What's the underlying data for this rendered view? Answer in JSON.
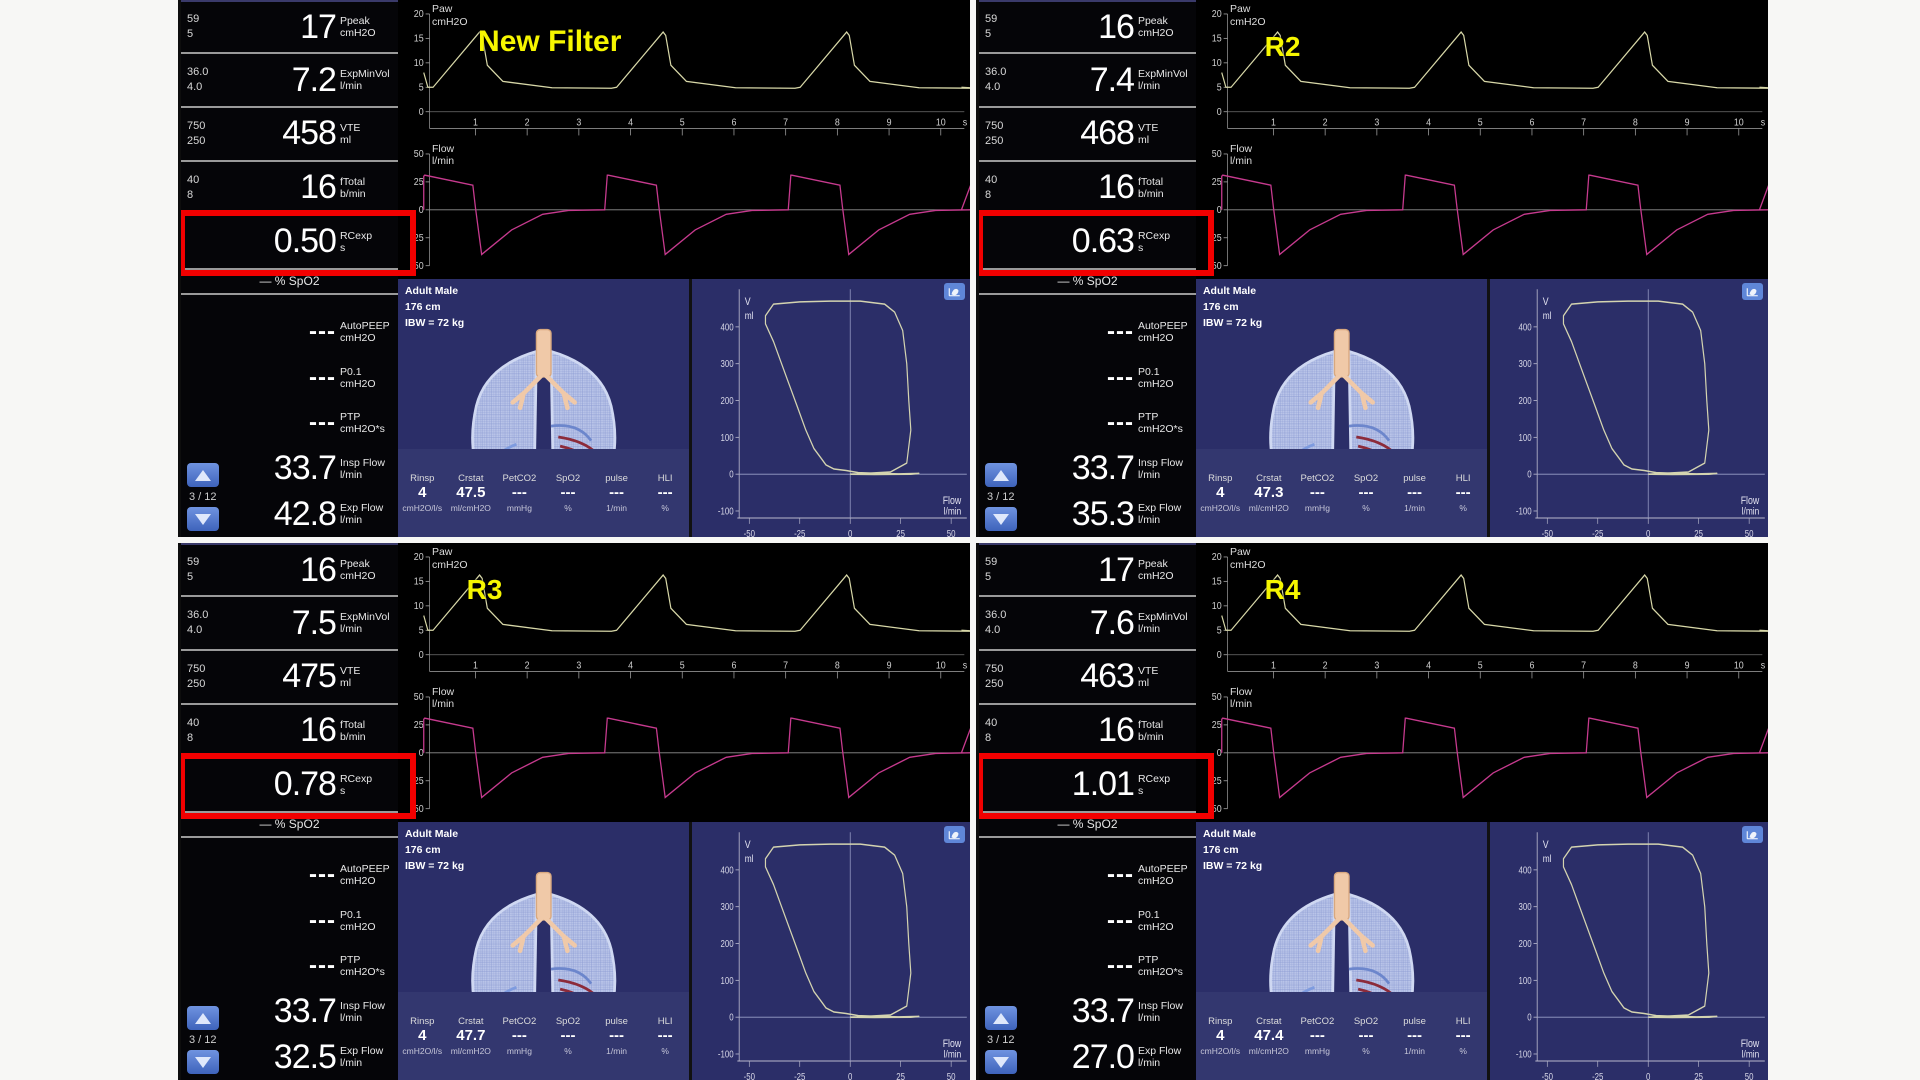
{
  "panels": [
    {
      "id": "p1",
      "annotation": "New Filter",
      "numeric": [
        {
          "hi": "59",
          "lo": "5",
          "value": "17",
          "label": "Ppeak",
          "unit": "cmH2O"
        },
        {
          "hi": "36.0",
          "lo": "4.0",
          "value": "7.2",
          "label": "ExpMinVol",
          "unit": "l/min"
        },
        {
          "hi": "750",
          "lo": "250",
          "value": "458",
          "label": "VTE",
          "unit": "ml"
        },
        {
          "hi": "40",
          "lo": "8",
          "value": "16",
          "label": "fTotal",
          "unit": "b/min"
        }
      ],
      "rcexp": {
        "value": "0.50",
        "label": "RCexp",
        "unit": "s"
      },
      "spo2_label": "— % SpO2",
      "dashed": [
        {
          "value": "---",
          "label": "AutoPEEP",
          "unit": "cmH2O"
        },
        {
          "value": "---",
          "label": "P0.1",
          "unit": "cmH2O"
        },
        {
          "value": "---",
          "label": "PTP",
          "unit": "cmH2O*s"
        }
      ],
      "flows": [
        {
          "value": "33.7",
          "label": "Insp Flow",
          "unit": "l/min"
        },
        {
          "value": "42.8",
          "label": "Exp Flow",
          "unit": "l/min"
        }
      ],
      "page": "3 / 12",
      "paw": {
        "title": "Paw",
        "unit": "cmH2O",
        "yticks": [
          "20",
          "15",
          "10",
          "5",
          "0"
        ],
        "xticks": [
          "1",
          "2",
          "3",
          "4",
          "5",
          "6",
          "7",
          "8",
          "9",
          "10"
        ],
        "xend": "s"
      },
      "flow": {
        "title": "Flow",
        "unit": "l/min",
        "yticks": [
          "50",
          "25",
          "0",
          "-25",
          "-50"
        ]
      },
      "patient": {
        "type": "Adult Male",
        "height": "176 cm",
        "ibw": "IBW = 72 kg"
      },
      "status": [
        {
          "label": "Rinsp",
          "value": "4",
          "unit": "cmH2O/l/s"
        },
        {
          "label": "Crstat",
          "value": "47.5",
          "unit": "ml/cmH2O"
        },
        {
          "label": "PetCO2",
          "value": "---",
          "unit": "mmHg"
        },
        {
          "label": "SpO2",
          "value": "---",
          "unit": "%"
        },
        {
          "label": "pulse",
          "value": "---",
          "unit": "1/min"
        },
        {
          "label": "HLI",
          "value": "---",
          "unit": "%"
        }
      ],
      "loop": {
        "ylabel": "V",
        "yunit": "ml",
        "xlabel": "Flow",
        "xunit": "l/min",
        "yticks": [
          "400",
          "300",
          "200",
          "100",
          "0",
          "-100"
        ],
        "xticks": [
          "-50",
          "-25",
          "0",
          "25",
          "50"
        ]
      }
    },
    {
      "id": "p2",
      "annotation": "R2",
      "numeric": [
        {
          "hi": "59",
          "lo": "5",
          "value": "16",
          "label": "Ppeak",
          "unit": "cmH2O"
        },
        {
          "hi": "36.0",
          "lo": "4.0",
          "value": "7.4",
          "label": "ExpMinVol",
          "unit": "l/min"
        },
        {
          "hi": "750",
          "lo": "250",
          "value": "468",
          "label": "VTE",
          "unit": "ml"
        },
        {
          "hi": "40",
          "lo": "8",
          "value": "16",
          "label": "fTotal",
          "unit": "b/min"
        }
      ],
      "rcexp": {
        "value": "0.63",
        "label": "RCexp",
        "unit": "s"
      },
      "spo2_label": "— % SpO2",
      "dashed": [
        {
          "value": "---",
          "label": "AutoPEEP",
          "unit": "cmH2O"
        },
        {
          "value": "---",
          "label": "P0.1",
          "unit": "cmH2O"
        },
        {
          "value": "---",
          "label": "PTP",
          "unit": "cmH2O*s"
        }
      ],
      "flows": [
        {
          "value": "33.7",
          "label": "Insp Flow",
          "unit": "l/min"
        },
        {
          "value": "35.3",
          "label": "Exp Flow",
          "unit": "l/min"
        }
      ],
      "page": "3 / 12",
      "paw": {
        "title": "Paw",
        "unit": "cmH2O",
        "yticks": [
          "20",
          "15",
          "10",
          "5",
          "0"
        ],
        "xticks": [
          "1",
          "2",
          "3",
          "4",
          "5",
          "6",
          "7",
          "8",
          "9",
          "10"
        ],
        "xend": "s"
      },
      "flow": {
        "title": "Flow",
        "unit": "l/min",
        "yticks": [
          "50",
          "25",
          "0",
          "-25",
          "-50"
        ]
      },
      "patient": {
        "type": "Adult Male",
        "height": "176 cm",
        "ibw": "IBW = 72 kg"
      },
      "status": [
        {
          "label": "Rinsp",
          "value": "4",
          "unit": "cmH2O/l/s"
        },
        {
          "label": "Crstat",
          "value": "47.3",
          "unit": "ml/cmH2O"
        },
        {
          "label": "PetCO2",
          "value": "---",
          "unit": "mmHg"
        },
        {
          "label": "SpO2",
          "value": "---",
          "unit": "%"
        },
        {
          "label": "pulse",
          "value": "---",
          "unit": "1/min"
        },
        {
          "label": "HLI",
          "value": "---",
          "unit": "%"
        }
      ],
      "loop": {
        "ylabel": "V",
        "yunit": "ml",
        "xlabel": "Flow",
        "xunit": "l/min",
        "yticks": [
          "400",
          "300",
          "200",
          "100",
          "0",
          "-100"
        ],
        "xticks": [
          "-50",
          "-25",
          "0",
          "25",
          "50"
        ]
      }
    },
    {
      "id": "p3",
      "annotation": "R3",
      "numeric": [
        {
          "hi": "59",
          "lo": "5",
          "value": "16",
          "label": "Ppeak",
          "unit": "cmH2O"
        },
        {
          "hi": "36.0",
          "lo": "4.0",
          "value": "7.5",
          "label": "ExpMinVol",
          "unit": "l/min"
        },
        {
          "hi": "750",
          "lo": "250",
          "value": "475",
          "label": "VTE",
          "unit": "ml"
        },
        {
          "hi": "40",
          "lo": "8",
          "value": "16",
          "label": "fTotal",
          "unit": "b/min"
        }
      ],
      "rcexp": {
        "value": "0.78",
        "label": "RCexp",
        "unit": "s"
      },
      "spo2_label": "— % SpO2",
      "dashed": [
        {
          "value": "---",
          "label": "AutoPEEP",
          "unit": "cmH2O"
        },
        {
          "value": "---",
          "label": "P0.1",
          "unit": "cmH2O"
        },
        {
          "value": "---",
          "label": "PTP",
          "unit": "cmH2O*s"
        }
      ],
      "flows": [
        {
          "value": "33.7",
          "label": "Insp Flow",
          "unit": "l/min"
        },
        {
          "value": "32.5",
          "label": "Exp Flow",
          "unit": "l/min"
        }
      ],
      "page": "3 / 12",
      "paw": {
        "title": "Paw",
        "unit": "cmH2O",
        "yticks": [
          "20",
          "15",
          "10",
          "5",
          "0"
        ],
        "xticks": [
          "1",
          "2",
          "3",
          "4",
          "5",
          "6",
          "7",
          "8",
          "9",
          "10"
        ],
        "xend": "s"
      },
      "flow": {
        "title": "Flow",
        "unit": "l/min",
        "yticks": [
          "50",
          "25",
          "0",
          "-25",
          "-50"
        ]
      },
      "patient": {
        "type": "Adult Male",
        "height": "176 cm",
        "ibw": "IBW = 72 kg"
      },
      "status": [
        {
          "label": "Rinsp",
          "value": "4",
          "unit": "cmH2O/l/s"
        },
        {
          "label": "Crstat",
          "value": "47.7",
          "unit": "ml/cmH2O"
        },
        {
          "label": "PetCO2",
          "value": "---",
          "unit": "mmHg"
        },
        {
          "label": "SpO2",
          "value": "---",
          "unit": "%"
        },
        {
          "label": "pulse",
          "value": "---",
          "unit": "1/min"
        },
        {
          "label": "HLI",
          "value": "---",
          "unit": "%"
        }
      ],
      "loop": {
        "ylabel": "V",
        "yunit": "ml",
        "xlabel": "Flow",
        "xunit": "l/min",
        "yticks": [
          "400",
          "300",
          "200",
          "100",
          "0",
          "-100"
        ],
        "xticks": [
          "-50",
          "-25",
          "0",
          "25",
          "50"
        ]
      }
    },
    {
      "id": "p4",
      "annotation": "R4",
      "numeric": [
        {
          "hi": "59",
          "lo": "5",
          "value": "17",
          "label": "Ppeak",
          "unit": "cmH2O"
        },
        {
          "hi": "36.0",
          "lo": "4.0",
          "value": "7.6",
          "label": "ExpMinVol",
          "unit": "l/min"
        },
        {
          "hi": "750",
          "lo": "250",
          "value": "463",
          "label": "VTE",
          "unit": "ml"
        },
        {
          "hi": "40",
          "lo": "8",
          "value": "16",
          "label": "fTotal",
          "unit": "b/min"
        }
      ],
      "rcexp": {
        "value": "1.01",
        "label": "RCexp",
        "unit": "s"
      },
      "spo2_label": "— % SpO2",
      "dashed": [
        {
          "value": "---",
          "label": "AutoPEEP",
          "unit": "cmH2O"
        },
        {
          "value": "---",
          "label": "P0.1",
          "unit": "cmH2O"
        },
        {
          "value": "---",
          "label": "PTP",
          "unit": "cmH2O*s"
        }
      ],
      "flows": [
        {
          "value": "33.7",
          "label": "Insp Flow",
          "unit": "l/min"
        },
        {
          "value": "27.0",
          "label": "Exp Flow",
          "unit": "l/min"
        }
      ],
      "page": "3 / 12",
      "paw": {
        "title": "Paw",
        "unit": "cmH2O",
        "yticks": [
          "20",
          "15",
          "10",
          "5",
          "0"
        ],
        "xticks": [
          "1",
          "2",
          "3",
          "4",
          "5",
          "6",
          "7",
          "8",
          "9",
          "10"
        ],
        "xend": "s"
      },
      "flow": {
        "title": "Flow",
        "unit": "l/min",
        "yticks": [
          "50",
          "25",
          "0",
          "-25",
          "-50"
        ]
      },
      "patient": {
        "type": "Adult Male",
        "height": "176 cm",
        "ibw": "IBW = 72 kg"
      },
      "status": [
        {
          "label": "Rinsp",
          "value": "4",
          "unit": "cmH2O/l/s"
        },
        {
          "label": "Crstat",
          "value": "47.4",
          "unit": "ml/cmH2O"
        },
        {
          "label": "PetCO2",
          "value": "---",
          "unit": "mmHg"
        },
        {
          "label": "SpO2",
          "value": "---",
          "unit": "%"
        },
        {
          "label": "pulse",
          "value": "---",
          "unit": "1/min"
        },
        {
          "label": "HLI",
          "value": "---",
          "unit": "%"
        }
      ],
      "loop": {
        "ylabel": "V",
        "yunit": "ml",
        "xlabel": "Flow",
        "xunit": "l/min",
        "yticks": [
          "400",
          "300",
          "200",
          "100",
          "0",
          "-100"
        ],
        "xticks": [
          "-50",
          "-25",
          "0",
          "25",
          "50"
        ]
      }
    }
  ],
  "colors": {
    "paw_trace": "#d8d8a8",
    "flow_trace": "#c63a8e",
    "loop_trace": "#d4d4b0",
    "highlight_box": "#f20000",
    "annotation": "#f6f600",
    "panel_bg": "#000000",
    "patient_bg": "#2b2e68"
  }
}
